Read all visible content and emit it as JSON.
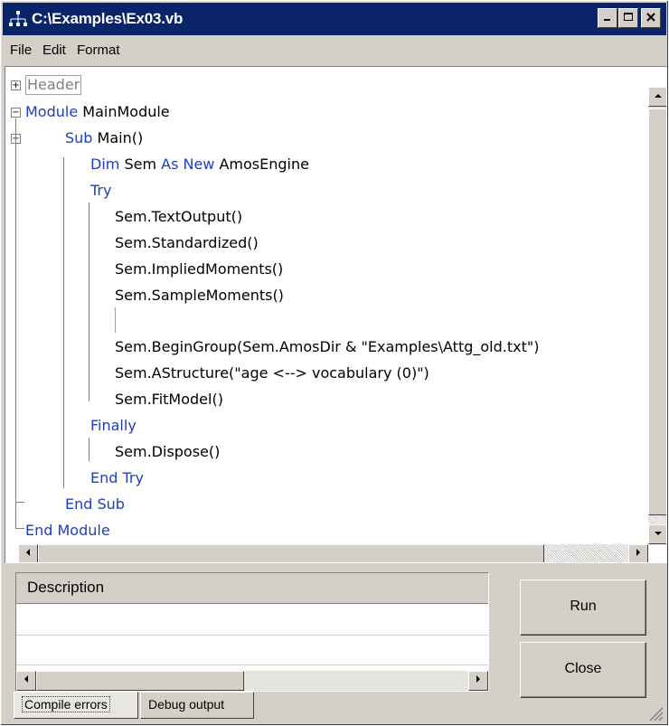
{
  "window": {
    "title": "C:\\Examples\\Ex03.vb"
  },
  "menu": {
    "file": "File",
    "edit": "Edit",
    "format": "Format"
  },
  "code": {
    "header": "Header",
    "l_module_kw": "Module",
    "l_module_name": " MainModule",
    "l_sub_kw": "Sub",
    "l_sub_name": " Main()",
    "l_dim_kw1": "Dim",
    "l_dim_mid": " Sem ",
    "l_dim_kw2": "As New",
    "l_dim_end": " AmosEngine",
    "l_try": "Try",
    "l_textoutput": "Sem.TextOutput()",
    "l_standardized": "Sem.Standardized()",
    "l_implied": "Sem.ImpliedMoments()",
    "l_sample": "Sem.SampleMoments()",
    "l_begingroup": "Sem.BeginGroup(Sem.AmosDir & \"Examples\\Attg_old.txt\")",
    "l_astructure": "Sem.AStructure(\"age <--> vocabulary (0)\")",
    "l_fitmodel": "Sem.FitModel()",
    "l_finally": "Finally",
    "l_dispose": "Sem.Dispose()",
    "l_endtry": "End Try",
    "l_endsub": "End Sub",
    "l_endmodule": "End Module"
  },
  "errors": {
    "column_header": "Description"
  },
  "tabs": {
    "compile": "Compile errors",
    "debug": "Debug output"
  },
  "buttons": {
    "run": "Run",
    "close": "Close"
  },
  "icons": {
    "app": "network-icon",
    "minimize": "minimize-icon",
    "maximize": "maximize-icon",
    "close": "close-icon"
  },
  "colors": {
    "keyword": "#1f3fbf",
    "titlebar": "#0a246a",
    "chrome": "#d4d0c8"
  }
}
